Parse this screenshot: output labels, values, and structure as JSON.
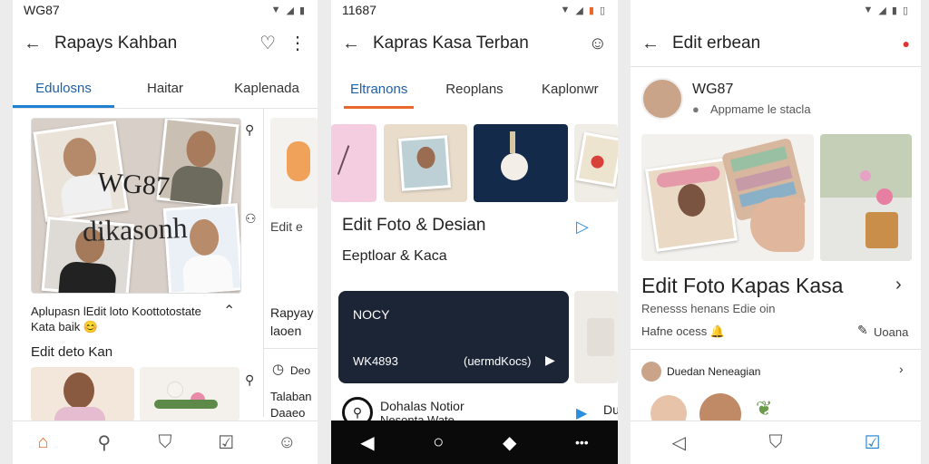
{
  "phone1": {
    "status_time": "WG87",
    "title": "Rapays Kahban",
    "tabs": [
      "Edulosns",
      "Haitar",
      "Kaplenada"
    ],
    "collage_text_1": "WG87",
    "collage_text_2": "dikasonh",
    "caption_line1": "Aplupasn lEdit loto Koottotostate",
    "caption_line2": "Kata baik 😊",
    "subheading": "Edit deto Kan",
    "side_text_1": "Edit e",
    "side_text_2": "Rapyay",
    "side_text_3": "laoen",
    "side_text_4": "Deo",
    "side_text_5": "Talaban",
    "side_text_6": "Daaeo"
  },
  "phone2": {
    "status_time": "11687",
    "title": "Kapras Kasa Terban",
    "tabs": [
      "Eltranons",
      "Reoplans",
      "Kaplonwr"
    ],
    "heading": "Edit Foto & Desian",
    "subheading": "Eeptloar & Kaca",
    "card_title": "NOCY",
    "card_code": "WK4893",
    "card_link": "(uermdKocs)",
    "side_label": "Du",
    "bottom_title": "Dohalas Notior",
    "bottom_sub": "Nesonta Wate"
  },
  "phone3": {
    "title": "Edit  erbean",
    "profile_name": "WG87",
    "profile_sub": "Appmame le stacla",
    "heading": "Edit Foto Kapas Kasa",
    "sub1": "Renesss henans Edie oin",
    "sub2": "Hafne ocess 🔔",
    "action": "Uoana",
    "comment_name": "Duedan Neneagian"
  }
}
